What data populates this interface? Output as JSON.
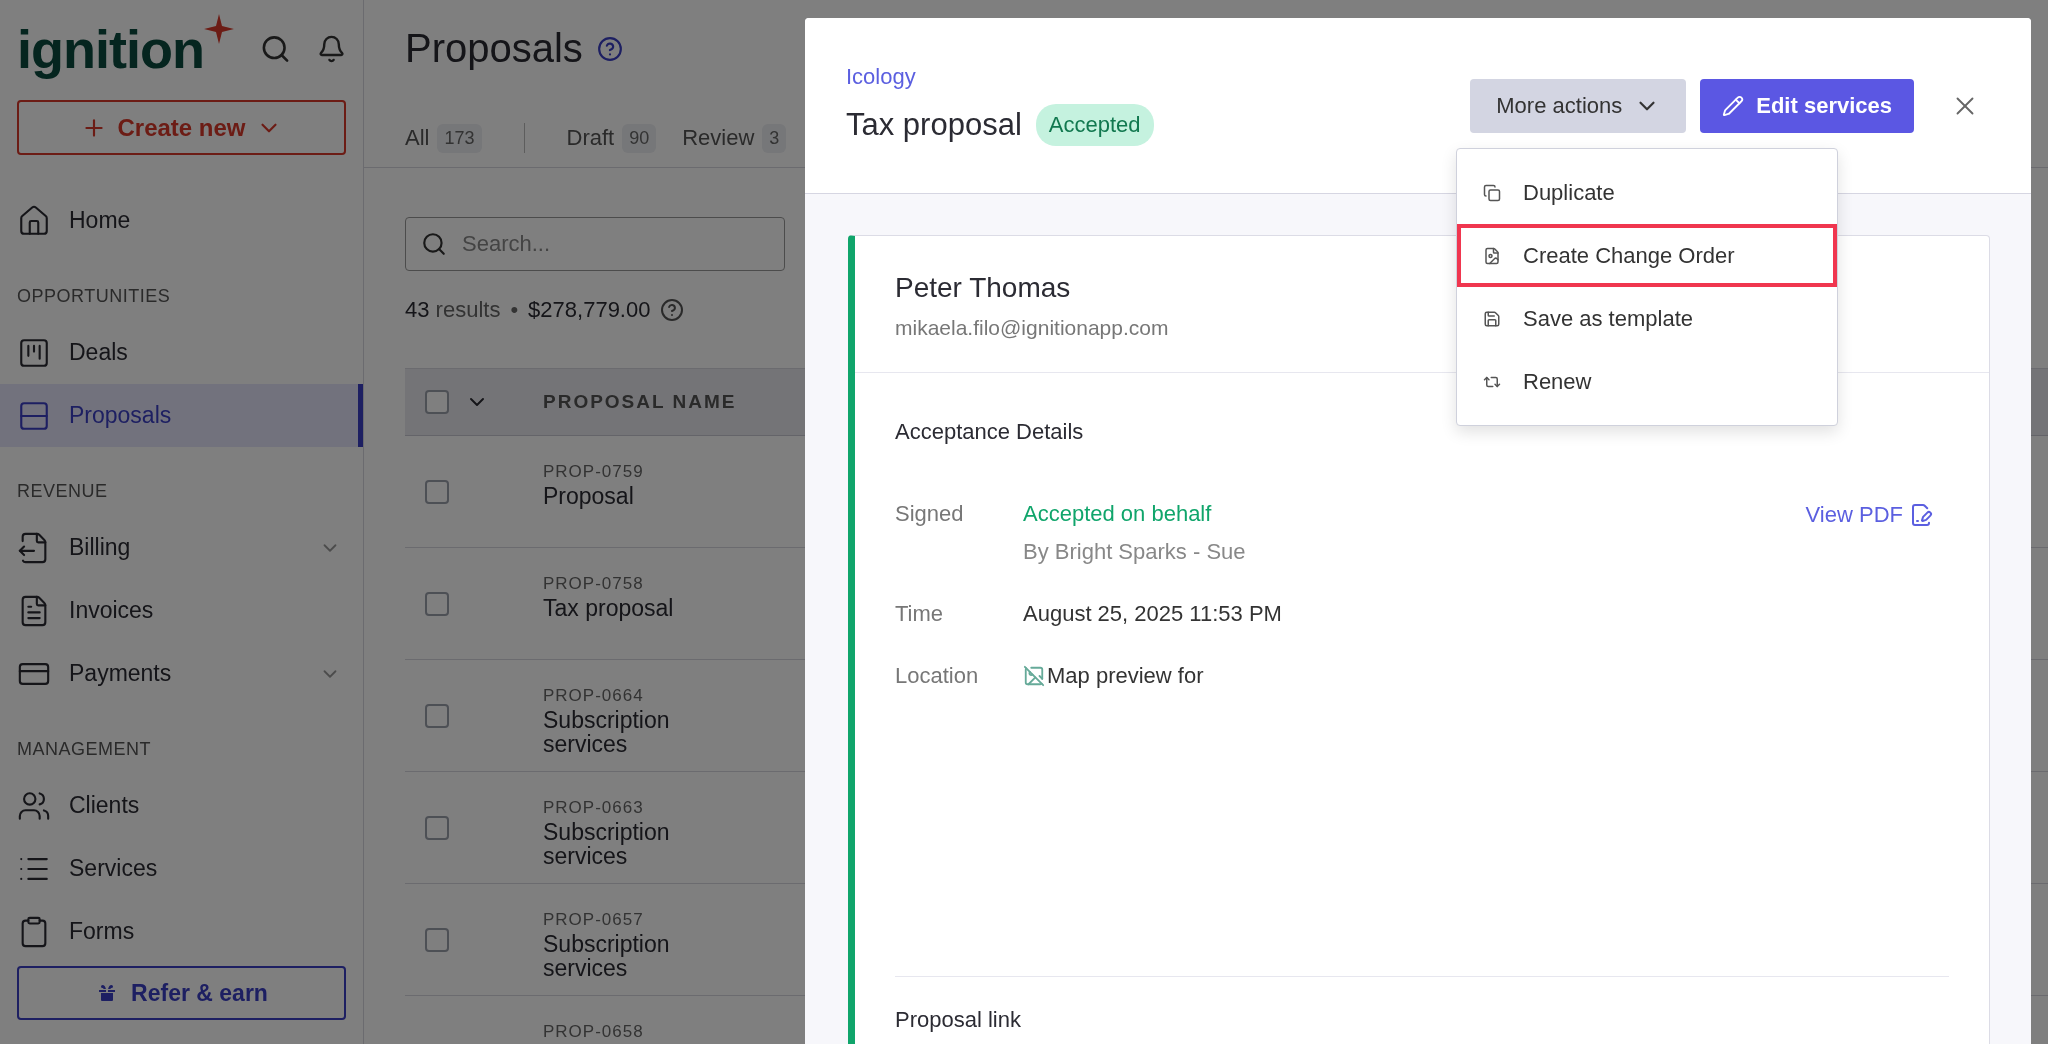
{
  "sidebar": {
    "logo": "ignition",
    "create_button": "Create new",
    "sections": [
      {
        "items": [
          {
            "label": "Home",
            "selected": false,
            "collapsible": false
          }
        ]
      },
      {
        "heading": "OPPORTUNITIES",
        "items": [
          {
            "label": "Deals",
            "selected": false,
            "collapsible": false
          },
          {
            "label": "Proposals",
            "selected": true,
            "collapsible": false
          }
        ]
      },
      {
        "heading": "REVENUE",
        "items": [
          {
            "label": "Billing",
            "selected": false,
            "collapsible": true
          },
          {
            "label": "Invoices",
            "selected": false,
            "collapsible": false
          },
          {
            "label": "Payments",
            "selected": false,
            "collapsible": true
          }
        ]
      },
      {
        "heading": "MANAGEMENT",
        "items": [
          {
            "label": "Clients",
            "selected": false,
            "collapsible": false
          },
          {
            "label": "Services",
            "selected": false,
            "collapsible": false
          },
          {
            "label": "Forms",
            "selected": false,
            "collapsible": false
          }
        ]
      }
    ],
    "refer_button": "Refer & earn"
  },
  "main": {
    "title": "Proposals",
    "tabs": [
      {
        "label": "All",
        "count": "173"
      },
      {
        "label": "Draft",
        "count": "90"
      },
      {
        "label": "Review",
        "count": "3"
      }
    ],
    "search": {
      "placeholder": "Search..."
    },
    "summary": {
      "count": "43",
      "count_label": "results",
      "separator": "•",
      "total": "$278,779.00"
    },
    "table": {
      "select_all": {
        "checked": false
      },
      "columns": [
        "PROPOSAL NAME"
      ],
      "rows": [
        {
          "id": "PROP-0759",
          "name": "Proposal",
          "checked": false
        },
        {
          "id": "PROP-0758",
          "name": "Tax proposal",
          "checked": false
        },
        {
          "id": "PROP-0664",
          "name": "Subscription services",
          "checked": false
        },
        {
          "id": "PROP-0663",
          "name": "Subscription services",
          "checked": false
        },
        {
          "id": "PROP-0657",
          "name": "Subscription services",
          "checked": false
        },
        {
          "id": "PROP-0658"
        }
      ]
    }
  },
  "modal": {
    "breadcrumb": "Icology",
    "title": "Tax proposal",
    "status": "Accepted",
    "more_actions": {
      "label": "More actions",
      "expanded": true,
      "items": [
        {
          "label": "Duplicate",
          "highlighted": false
        },
        {
          "label": "Create Change Order",
          "highlighted": true
        },
        {
          "label": "Save as template",
          "highlighted": false
        },
        {
          "label": "Renew",
          "highlighted": false
        }
      ]
    },
    "edit_button": "Edit services",
    "card": {
      "name": "Peter Thomas",
      "email": "mikaela.filo@ignitionapp.com",
      "section_title": "Acceptance Details",
      "rows": [
        {
          "label": "Signed",
          "kind": "status",
          "value": "Accepted on behalf",
          "detail": "By Bright Sparks - Sue",
          "link": "View PDF"
        },
        {
          "label": "Time",
          "kind": "text",
          "value": "August 25, 2025 11:53 PM"
        },
        {
          "label": "Location",
          "kind": "image",
          "value": "Map preview for"
        }
      ],
      "footer_title": "Proposal link"
    }
  }
}
